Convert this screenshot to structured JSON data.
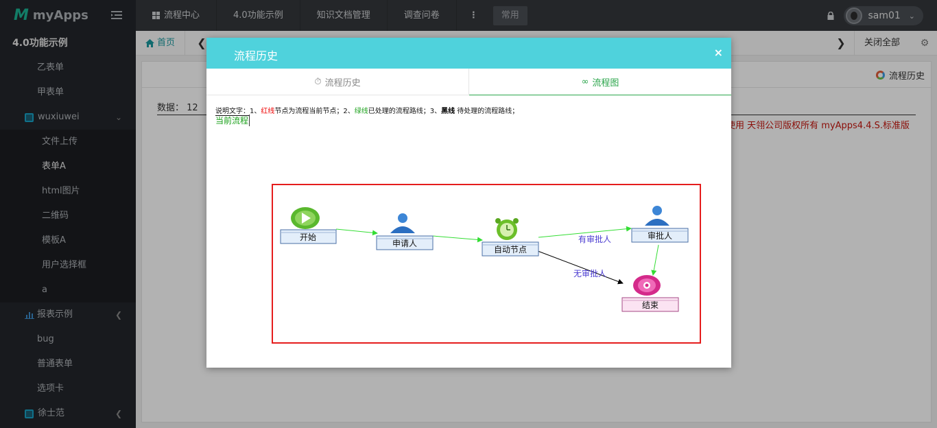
{
  "sidebar": {
    "brand_logo": "M",
    "brand_name": "myApps",
    "section_title": "4.0功能示例",
    "items": [
      {
        "label": "乙表单"
      },
      {
        "label": "甲表单"
      }
    ],
    "group_wuxiuwei": {
      "label": "wuxiuwei",
      "children": [
        "文件上传",
        "表单A",
        "html图片",
        "二维码",
        "模板A",
        "用户选择框",
        "a"
      ]
    },
    "group_report": {
      "label": "报表示例"
    },
    "items2": [
      "bug",
      "普通表单",
      "选项卡"
    ],
    "group_xu": {
      "label": "徐士范"
    }
  },
  "topbar": {
    "nav": [
      "流程中心",
      "4.0功能示例",
      "知识文档管理",
      "调查问卷"
    ],
    "more": "⋮",
    "common": "常用",
    "username": "sam01"
  },
  "tabbar": {
    "home": "首页",
    "close_all": "关闭全部"
  },
  "content": {
    "flow_history_btn": "流程历史",
    "data_label": "数据：",
    "data_value": "12",
    "copyright": "部使用 天翎公司版权所有 myApps4.4.S.标准版"
  },
  "modal": {
    "title": "流程历史",
    "close": "×",
    "tabs": [
      "流程历史",
      "流程图"
    ],
    "legend": {
      "prefix": "说明文字：",
      "p1": "1、",
      "red": "红线",
      "t1": "节点为流程当前节点；2、",
      "green": "绿线",
      "t2": "已处理的流程路线；3、",
      "black": "黑线",
      "t3": " 待处理的流程路线；"
    },
    "current_flow": "当前流程",
    "diagram": {
      "nodes": {
        "start": "开始",
        "applicant": "申请人",
        "auto": "自动节点",
        "approver": "审批人",
        "end": "结束"
      },
      "edges": {
        "has_approver": "有审批人",
        "no_approver": "无审批人"
      },
      "colors": {
        "processed": "#33dd33",
        "pending": "#000000",
        "current": "#e51c1c"
      }
    }
  }
}
